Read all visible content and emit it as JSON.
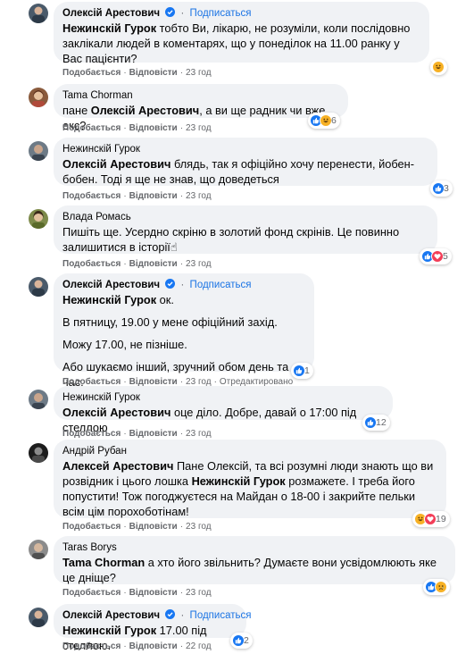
{
  "comments": [
    {
      "author": "Олексій Арестович",
      "verified": true,
      "subscribe": "Подписаться",
      "mention": "Нежинскій Гурок",
      "text": " тобто Ви, лікарю, не розуміли, коли послідовно заклікали людей в коментарях, що у понеділок на 11.00 ранку у Вас пацієнти?",
      "like": "Подобається",
      "reply": "Відповісти",
      "time": "23 год",
      "reactions": [
        "haha"
      ],
      "reaction_count": ""
    },
    {
      "author": "Tama Chorman",
      "text_prefix": "пане ",
      "mention": "Олексій Арестович",
      "text": ", а ви ще радник чи вже екс?",
      "like": "Подобається",
      "reply": "Відповісти",
      "time": "23 год",
      "reactions": [
        "like",
        "haha"
      ],
      "reaction_count": "6"
    },
    {
      "author": "Нежинскій Гурок",
      "mention": "Олексій Арестович",
      "text": " блядь, так я офіційно хочу перенести, йобен-бобен. Тоді я ще не знав, що доведеться",
      "like": "Подобається",
      "reply": "Відповісти",
      "time": "23 год",
      "reactions": [
        "like"
      ],
      "reaction_count": "3"
    },
    {
      "author": "Влада Ромась",
      "text": "Пишіть ще. Усердно скріню в золотий фонд скрінів. Це повинно залишитися в історії☝",
      "like": "Подобається",
      "reply": "Відповісти",
      "time": "23 год",
      "reactions": [
        "like",
        "love"
      ],
      "reaction_count": "5"
    },
    {
      "author": "Олексій Арестович",
      "verified": true,
      "subscribe": "Подписаться",
      "mention": "Нежинскій Гурок",
      "text": " ок.",
      "paragraphs": [
        "В пятницу, 19.00 у мене офіційний захід.",
        "Можу 17.00, не пізніше.",
        "Або шукаємо інший, зручний обом день та час."
      ],
      "like": "Подобається",
      "reply": "Відповісти",
      "time": "23 год",
      "edited": "Отредактировано",
      "reactions": [
        "like"
      ],
      "reaction_count": "1"
    },
    {
      "author": "Нежинскій Гурок",
      "mention": "Олексій Арестович",
      "text": " оце діло. Добре, давай о 17:00 під стеллою",
      "like": "Подобається",
      "reply": "Відповісти",
      "time": "23 год",
      "reactions": [
        "like"
      ],
      "reaction_count": "12"
    },
    {
      "author": "Андрій Рубан",
      "mention": "Алексей Арестович",
      "text": " Пане Олексій, та всі розумні люди знають що ви розвідник і цього лошка ",
      "mention2": "Нежинскій Гурок",
      "text2": " розмажете. І треба його попустити! Тож погоджуєтеся на Майдан о 18-00 і закрийте пельки всім цім порохоботінам!",
      "like": "Подобається",
      "reply": "Відповісти",
      "time": "23 год",
      "reactions": [
        "haha",
        "love"
      ],
      "reaction_count": "19"
    },
    {
      "author": "Taras Borys",
      "mention": "Tama Chorman",
      "text": " а хто його звільнить? Думаєте вони усвідомлюють яке це дніще?",
      "like": "Подобається",
      "reply": "Відповісти",
      "time": "23 год",
      "reactions": [
        "like",
        "sad"
      ],
      "reaction_count": ""
    },
    {
      "author": "Олексій Арестович",
      "verified": true,
      "subscribe": "Подписаться",
      "mention": "Нежинскій Гурок",
      "text": " 17.00 під стеллою.",
      "like": "Подобається",
      "reply": "Відповісти",
      "time": "22 год",
      "reactions": [
        "like"
      ],
      "reaction_count": "2"
    }
  ],
  "colors": {
    "bubble": "#f0f2f5",
    "link": "#1b74e4",
    "meta": "#65676b",
    "like": "#1877f2",
    "love": "#f33e58",
    "haha": "#f7b125"
  }
}
